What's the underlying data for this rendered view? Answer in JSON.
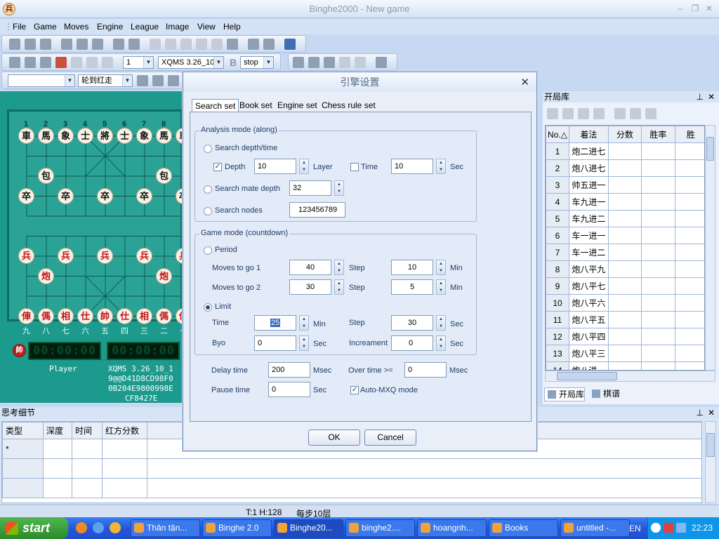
{
  "window": {
    "title": "Binghe2000 - New game",
    "app_icon_char": "兵"
  },
  "menu": [
    "File",
    "Game",
    "Moves",
    "Engine",
    "League",
    "Image",
    "View",
    "Help"
  ],
  "toolbar2": {
    "level_value": "1",
    "engine_value": "XQMS 3.26_10",
    "bold_label": "B",
    "stop_value": "stop"
  },
  "toolbar3": {
    "turn_value": "轮到红走"
  },
  "board": {
    "top_numbers": [
      "1",
      "2",
      "3",
      "4",
      "5",
      "6",
      "7",
      "8",
      "9"
    ],
    "bottom_numbers": [
      "九",
      "八",
      "七",
      "六",
      "五",
      "四",
      "三",
      "二",
      "一"
    ],
    "top_row": [
      "車",
      "馬",
      "象",
      "士",
      "將",
      "士",
      "象",
      "馬",
      "車"
    ],
    "cannons_black": [
      "包",
      "包"
    ],
    "black_soldiers": [
      "卒",
      "卒",
      "卒",
      "卒",
      "卒"
    ],
    "red_soldiers": [
      "兵",
      "兵",
      "兵",
      "兵",
      "兵"
    ],
    "cannons_red": [
      "炮",
      "炮"
    ],
    "bottom_row": [
      "俥",
      "傌",
      "相",
      "仕",
      "帥",
      "仕",
      "相",
      "傌",
      "俥"
    ],
    "clock_left": "00:00:00",
    "clock_right": "00:00:00",
    "red_badge": "帥",
    "player_label": "Player",
    "engine_info": [
      "XQMS 3.26_10_1",
      "9@@D41D8CD98F0",
      "0B204E9800998E",
      "CF8427E"
    ]
  },
  "opening_panel": {
    "title": "开局库",
    "columns": [
      "No.△",
      "着法",
      "分数",
      "胜率",
      "胜"
    ],
    "rows": [
      {
        "no": "1",
        "move": "炮二进七"
      },
      {
        "no": "2",
        "move": "炮八进七"
      },
      {
        "no": "3",
        "move": "帅五进一"
      },
      {
        "no": "4",
        "move": "车九进一"
      },
      {
        "no": "5",
        "move": "车九进二"
      },
      {
        "no": "6",
        "move": "车一进一"
      },
      {
        "no": "7",
        "move": "车一进二"
      },
      {
        "no": "8",
        "move": "炮八平九"
      },
      {
        "no": "9",
        "move": "炮八平七"
      },
      {
        "no": "10",
        "move": "炮八平六"
      },
      {
        "no": "11",
        "move": "炮八平五"
      },
      {
        "no": "12",
        "move": "炮八平四"
      },
      {
        "no": "13",
        "move": "炮八平三"
      },
      {
        "no": "14",
        "move": "炮八进一"
      }
    ],
    "tab_opening": "开局库",
    "tab_records": "棋谱"
  },
  "think_panel": {
    "title": "思考细节",
    "columns": [
      "类型",
      "深度",
      "时间",
      "红方分数"
    ],
    "first_cell": "*"
  },
  "status": {
    "pos": "T:1 H:128",
    "step": "每步10层"
  },
  "taskbar": {
    "start": "start",
    "tasks": [
      "Thân tặn...",
      "Binghe 2.0",
      "Binghe20...",
      "binghe2....",
      "hoangnh...",
      "Books",
      "untitled -..."
    ],
    "lang": "EN",
    "time": "22:23"
  },
  "dialog": {
    "title": "引擎设置",
    "tabs": [
      "Search set",
      "Book set",
      "Engine set",
      "Chess rule set"
    ],
    "analysis": {
      "group": "Analysis mode (along)",
      "search_depth_time": "Search depth/time",
      "depth_label": "Depth",
      "depth_value": "10",
      "layer_label": "Layer",
      "time_label": "Time",
      "time_value": "10",
      "sec_label": "Sec",
      "mate_label": "Search mate depth",
      "mate_value": "32",
      "nodes_label": "Search nodes",
      "nodes_value": "123456789"
    },
    "game": {
      "group": "Game mode (countdown)",
      "period_label": "Period",
      "moves1_label": "Moves to go 1",
      "moves1_value": "40",
      "moves1_step_label": "Step",
      "moves1_step_value": "10",
      "moves1_min_label": "Min",
      "moves2_label": "Moves to go 2",
      "moves2_value": "30",
      "moves2_step_label": "Step",
      "moves2_step_value": "5",
      "moves2_min_label": "Min",
      "limit_label": "Limit",
      "limit_time_label": "Time",
      "limit_time_value": "25",
      "limit_min_label": "Min",
      "limit_step_label": "Step",
      "limit_step_value": "30",
      "limit_sec_label": "Sec",
      "byo_label": "Byo",
      "byo_value": "0",
      "byo_sec_label": "Sec",
      "incr_label": "Increament",
      "incr_value": "0",
      "incr_sec_label": "Sec"
    },
    "misc": {
      "delay_label": "Delay time",
      "delay_value": "200",
      "delay_unit": "Msec",
      "over_label": "Over time >=",
      "over_value": "0",
      "over_unit": "Msec",
      "pause_label": "Pause time",
      "pause_value": "0",
      "pause_unit": "Sec",
      "auto_label": "Auto-MXQ mode"
    },
    "ok": "OK",
    "cancel": "Cancel"
  }
}
